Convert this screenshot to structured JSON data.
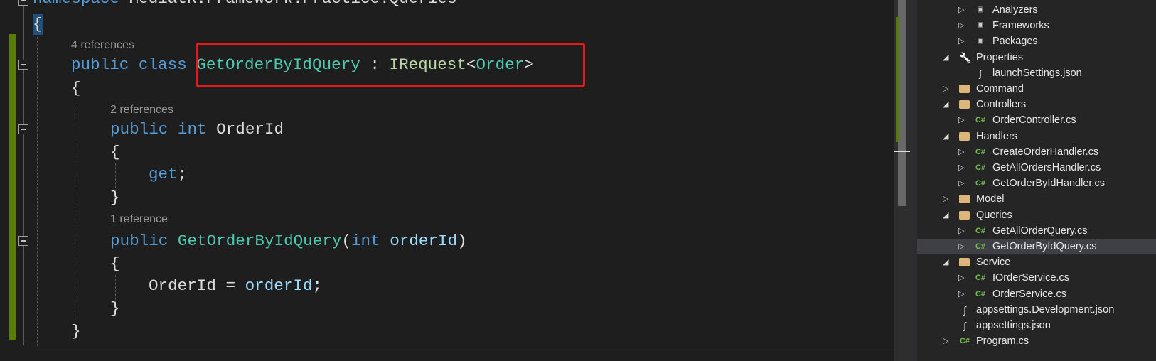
{
  "editor": {
    "lines": {
      "namespace_kw": "namespace",
      "namespace_name": " MediatR.Framework.Practice.Queries",
      "open_ns": "{",
      "lens_class": "4 references",
      "class_kw": "public class ",
      "class_name": "GetOrderByIdQuery",
      "class_colon": " : ",
      "class_iface": "IRequest",
      "class_lt": "<",
      "class_generic": "Order",
      "class_gt": ">",
      "open_class": "{",
      "lens_prop": "2 references",
      "prop_kw": "public int ",
      "prop_name": "OrderId",
      "open_prop": "{",
      "get_kw": "get",
      "get_semi": ";",
      "close_prop": "}",
      "lens_ctor": "1 reference",
      "ctor_kw": "public ",
      "ctor_name": "GetOrderByIdQuery",
      "ctor_open": "(",
      "ctor_param_kw": "int ",
      "ctor_param": "orderId",
      "ctor_close": ")",
      "open_ctor": "{",
      "assign_left": "OrderId = ",
      "assign_right": "orderId",
      "assign_semi": ";",
      "close_ctor": "}",
      "close_class": "}"
    },
    "highlight_color": "#e5191a"
  },
  "solution_explorer": {
    "items": [
      {
        "label": "Analyzers",
        "icon": "analyzer-icon",
        "expander": "collapsed"
      },
      {
        "label": "Frameworks",
        "icon": "framework-icon",
        "expander": "collapsed"
      },
      {
        "label": "Packages",
        "icon": "package-icon",
        "expander": "collapsed"
      },
      {
        "label": "Properties",
        "icon": "wrench-icon",
        "expander": "expanded"
      },
      {
        "label": "launchSettings.json",
        "icon": "json-file-icon",
        "expander": "none"
      },
      {
        "label": "Command",
        "icon": "folder-icon",
        "expander": "collapsed"
      },
      {
        "label": "Controllers",
        "icon": "folder-open-icon",
        "expander": "expanded"
      },
      {
        "label": "OrderController.cs",
        "icon": "csharp-file-icon",
        "expander": "collapsed"
      },
      {
        "label": "Handlers",
        "icon": "folder-open-icon",
        "expander": "expanded"
      },
      {
        "label": "CreateOrderHandler.cs",
        "icon": "csharp-file-icon",
        "expander": "collapsed"
      },
      {
        "label": "GetAllOrdersHandler.cs",
        "icon": "csharp-file-icon",
        "expander": "collapsed"
      },
      {
        "label": "GetOrderByIdHandler.cs",
        "icon": "csharp-file-icon",
        "expander": "collapsed"
      },
      {
        "label": "Model",
        "icon": "folder-icon",
        "expander": "collapsed"
      },
      {
        "label": "Queries",
        "icon": "folder-open-icon",
        "expander": "expanded"
      },
      {
        "label": "GetAllOrderQuery.cs",
        "icon": "csharp-file-icon",
        "expander": "collapsed"
      },
      {
        "label": "GetOrderByIdQuery.cs",
        "icon": "csharp-file-icon",
        "expander": "collapsed",
        "selected": true
      },
      {
        "label": "Service",
        "icon": "folder-open-icon",
        "expander": "expanded"
      },
      {
        "label": "IOrderService.cs",
        "icon": "csharp-file-icon",
        "expander": "collapsed"
      },
      {
        "label": "OrderService.cs",
        "icon": "csharp-file-icon",
        "expander": "collapsed"
      },
      {
        "label": "appsettings.Development.json",
        "icon": "json-file-icon",
        "expander": "none"
      },
      {
        "label": "appsettings.json",
        "icon": "json-file-icon",
        "expander": "none"
      },
      {
        "label": "Program.cs",
        "icon": "csharp-file-icon",
        "expander": "collapsed"
      }
    ],
    "csharp_glyph": "C#"
  }
}
